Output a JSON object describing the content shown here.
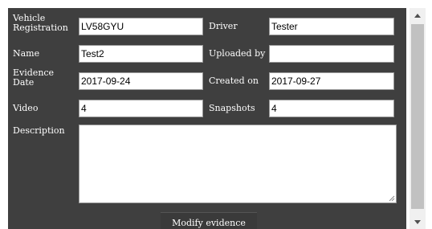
{
  "form": {
    "vehicle_registration": {
      "label": "Vehicle Registration",
      "value": "LV58GYU"
    },
    "driver": {
      "label": "Driver",
      "value": "Tester"
    },
    "name": {
      "label": "Name",
      "value": "Test2"
    },
    "uploaded_by": {
      "label": "Uploaded by",
      "value": ""
    },
    "evidence_date": {
      "label": "Evidence Date",
      "value": "2017-09-24"
    },
    "created_on": {
      "label": "Created on",
      "value": "2017-09-27"
    },
    "video": {
      "label": "Video",
      "value": "4"
    },
    "snapshots": {
      "label": "Snapshots",
      "value": "4"
    },
    "description": {
      "label": "Description",
      "value": ""
    }
  },
  "actions": {
    "modify_label": "Modify evidence"
  },
  "icons": {
    "scroll_up": "chevron-up-icon",
    "scroll_down": "chevron-down-icon",
    "resize": "resize-grip-icon"
  },
  "colors": {
    "panel_background": "#3f3f3f",
    "label_text": "#ffffff",
    "field_background": "#ffffff",
    "scrollbar_track": "#f0f0f0",
    "scrollbar_thumb": "#c1c1c1"
  }
}
